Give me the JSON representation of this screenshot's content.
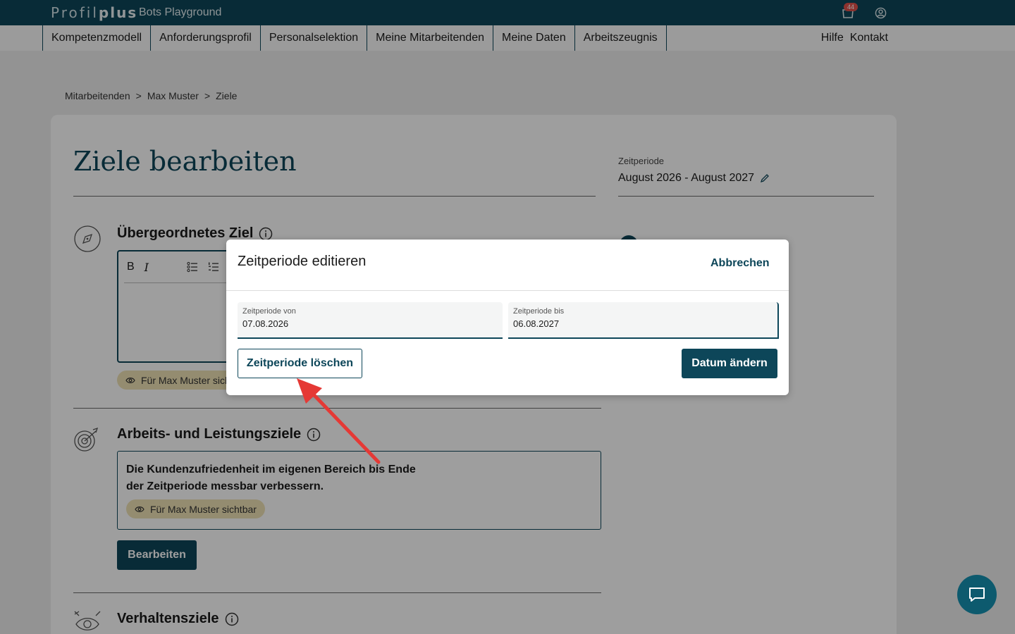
{
  "app": {
    "logo_regular": "Profil",
    "logo_bold": "plus",
    "name": "Bots Playground",
    "cart_count": "44"
  },
  "nav": {
    "items": [
      "Kompetenzmodell",
      "Anforderungsprofil",
      "Personalselektion",
      "Meine Mitarbeitenden",
      "Meine Daten",
      "Arbeitszeugnis"
    ],
    "help": "Hilfe",
    "contact": "Kontakt"
  },
  "breadcrumb": {
    "items": [
      "Mitarbeitenden",
      "Max Muster",
      "Ziele"
    ],
    "separator": ">"
  },
  "page": {
    "title": "Ziele bearbeiten",
    "zeitperiode_label": "Zeitperiode",
    "zeitperiode_value": "August 2026 - August 2027"
  },
  "sections": {
    "uebergeordnet": {
      "title": "Übergeordnetes Ziel",
      "visibility_chip": "Für Max Muster sichtbar"
    },
    "arbeit": {
      "title": "Arbeits- und Leistungsziele",
      "goal_text": "Die Kundenzufriedenheit im eigenen Bereich bis Ende der Zeitperiode messbar verbessern.",
      "visibility_chip": "Für Max Muster sichtbar",
      "edit_button": "Bearbeiten"
    },
    "verhalten": {
      "title": "Verhaltensziele"
    }
  },
  "editor": {
    "bold": "B",
    "italic": "I"
  },
  "modal": {
    "title": "Zeitperiode editieren",
    "cancel": "Abbrechen",
    "from_label": "Zeitperiode von",
    "from_value": "07.08.2026",
    "to_label": "Zeitperiode bis",
    "to_value": "06.08.2027",
    "delete_button": "Zeitperiode löschen",
    "change_button": "Datum ändern"
  },
  "colors": {
    "primary": "#0d4659",
    "chip": "#efe3b5",
    "badge": "#e0524b",
    "arrow": "#e53935"
  }
}
